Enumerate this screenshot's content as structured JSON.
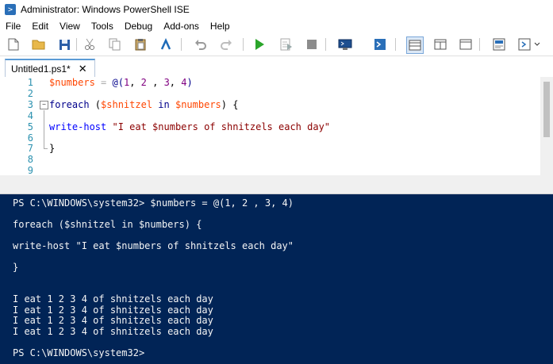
{
  "window": {
    "title": "Administrator: Windows PowerShell ISE"
  },
  "menu": [
    "File",
    "Edit",
    "View",
    "Tools",
    "Debug",
    "Add-ons",
    "Help"
  ],
  "toolbar": {
    "icons": [
      "new-icon",
      "open-icon",
      "save-icon",
      "cut-icon",
      "copy-icon",
      "paste-icon",
      "clear-console-icon",
      "undo-icon",
      "redo-icon",
      "run-icon",
      "run-selection-icon",
      "stop-icon",
      "remote-powershell-icon",
      "start-powershell-icon",
      "show-script-top-icon",
      "show-script-right-icon",
      "show-script-max-icon",
      "show-commands-icon",
      "show-addon-icon"
    ]
  },
  "tab": {
    "label": "Untitled1.ps1*",
    "close": "✕"
  },
  "editor": {
    "line_numbers": [
      "1",
      "2",
      "3",
      "4",
      "5",
      "6",
      "7",
      "8",
      "9"
    ],
    "lines": [
      [
        [
          "var",
          "$numbers"
        ],
        [
          "pl",
          " "
        ],
        [
          "op",
          "="
        ],
        [
          "pl",
          " "
        ],
        [
          "kw",
          "@("
        ],
        [
          "num",
          "1"
        ],
        [
          "pl",
          ", "
        ],
        [
          "num",
          "2"
        ],
        [
          "pl",
          " , "
        ],
        [
          "num",
          "3"
        ],
        [
          "pl",
          ", "
        ],
        [
          "num",
          "4"
        ],
        [
          "kw",
          ")"
        ]
      ],
      [],
      [
        [
          "kw",
          "foreach"
        ],
        [
          "pl",
          " ("
        ],
        [
          "var",
          "$shnitzel"
        ],
        [
          "pl",
          " "
        ],
        [
          "kw",
          "in"
        ],
        [
          "pl",
          " "
        ],
        [
          "var",
          "$numbers"
        ],
        [
          "pl",
          ") {"
        ]
      ],
      [],
      [
        [
          "cmd",
          "write-host"
        ],
        [
          "pl",
          " "
        ],
        [
          "str",
          "\"I eat $numbers of shnitzels each day\""
        ]
      ],
      [],
      [
        [
          "pl",
          "}"
        ]
      ],
      [],
      []
    ]
  },
  "console": {
    "lines": [
      "PS C:\\WINDOWS\\system32> $numbers = @(1, 2 , 3, 4)",
      "",
      "foreach ($shnitzel in $numbers) {",
      "",
      "write-host \"I eat $numbers of shnitzels each day\"",
      "",
      "}",
      "",
      "",
      "I eat 1 2 3 4 of shnitzels each day",
      "I eat 1 2 3 4 of shnitzels each day",
      "I eat 1 2 3 4 of shnitzels each day",
      "I eat 1 2 3 4 of shnitzels each day",
      "",
      "PS C:\\WINDOWS\\system32>"
    ]
  }
}
